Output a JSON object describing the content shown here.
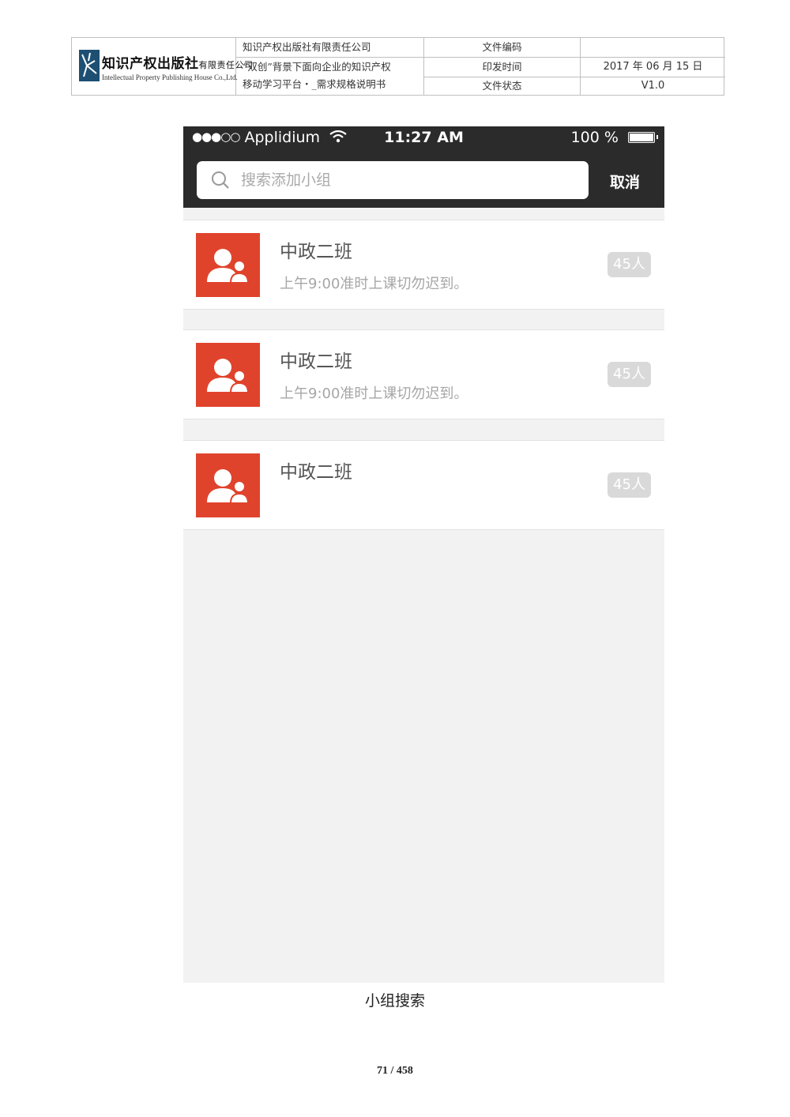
{
  "header": {
    "logo_cn": "知识产权出版社",
    "logo_cn_suffix": "有限责任公司",
    "logo_en": "Intellectual Property Publishing House Co.,Ltd.",
    "company": "知识产权出版社有限责任公司",
    "doc_title_line1": "“双创”背景下面向企业的知识产权",
    "doc_title_line2": "移动学习平台・_需求规格说明书",
    "labels": [
      "文件编码",
      "印发时间",
      "文件状态"
    ],
    "values": [
      "",
      "2017 年 06 月 15 日",
      "V1.0"
    ]
  },
  "phone": {
    "status": {
      "signal": "●●●○○",
      "carrier": "Applidium",
      "time": "11:27 AM",
      "battery": "100 %"
    },
    "search": {
      "placeholder": "搜索添加小组",
      "value": ""
    },
    "cancel_label": "取消",
    "groups": [
      {
        "name": "中政二班",
        "desc": "上午9:00准时上课切勿迟到。",
        "count": "45人"
      },
      {
        "name": "中政二班",
        "desc": "上午9:00准时上课切勿迟到。",
        "count": "45人"
      },
      {
        "name": "中政二班",
        "desc": "",
        "count": "45人"
      }
    ],
    "colors": {
      "topbar": "#2b2b2b",
      "avatar": "#e0432c",
      "background": "#f2f2f2"
    }
  },
  "caption": "小组搜索",
  "page_number": "71 / 458"
}
